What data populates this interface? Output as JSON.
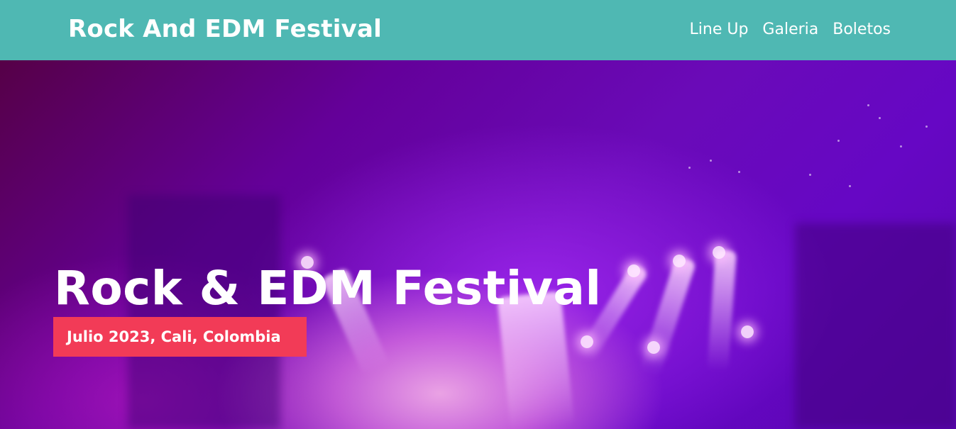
{
  "header": {
    "site_title": "Rock And EDM Festival",
    "background_color": "#4fb8b3",
    "nav": [
      {
        "label": "Line Up"
      },
      {
        "label": "Galeria"
      },
      {
        "label": "Boletos"
      }
    ]
  },
  "hero": {
    "title": "Rock & EDM Festival",
    "badge": "Julio 2023, Cali, Colombia",
    "badge_color": "#f23b57",
    "image_description_icon": "concert-stage-lights-image"
  }
}
